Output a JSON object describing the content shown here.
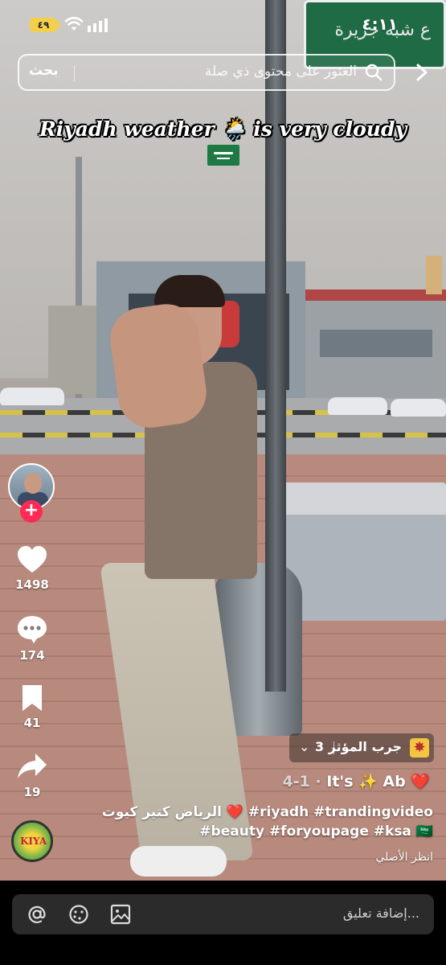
{
  "status_bar": {
    "time": "٤:١١",
    "battery_level": "٤٩",
    "icons": [
      "battery-icon",
      "wifi-icon",
      "signal-icon"
    ]
  },
  "search": {
    "button_label": "بحث",
    "placeholder": "العثور على محتوى ذي صلة"
  },
  "video": {
    "overlay_text": "Riyadh weather 🌦️ is very cloudy",
    "street_sign_text": "ع شبه جزيرة"
  },
  "actions": {
    "likes": "1498",
    "comments": "174",
    "saves": "41",
    "shares": "19",
    "follow_symbol": "+"
  },
  "effect": {
    "label": "جرب المؤثر",
    "count": "3"
  },
  "music": {
    "title": "It's ✨ Ab ❤️",
    "track_index": "4-1 ·"
  },
  "description": {
    "line1": "الرياض كتير كيوت ❤️ #riyadh #trandingvideo",
    "line2": "#beauty #foryoupage #ksa 🇸🇦",
    "see_original": "انظر الأصلي"
  },
  "disc_label": "KIYA",
  "comment_bar": {
    "placeholder": "إضافة تعليق..."
  },
  "colors": {
    "accent": "#fe2c55",
    "effect_icon": "#f5c542",
    "comment_bg": "#2b2b2b"
  }
}
